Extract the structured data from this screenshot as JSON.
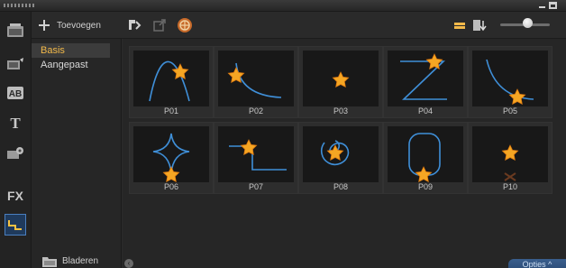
{
  "window": {
    "controls": [
      "minimize",
      "maximize"
    ]
  },
  "sidebar": {
    "icons": [
      {
        "name": "media-icon"
      },
      {
        "name": "instant-project-icon"
      },
      {
        "name": "title-icon",
        "text": "AB"
      },
      {
        "name": "text-icon",
        "text": "T"
      },
      {
        "name": "transition-icon"
      },
      {
        "name": "fx-icon",
        "text": "FX"
      },
      {
        "name": "path-icon",
        "active": true
      }
    ]
  },
  "toolbar": {
    "add_label": "Toevoegen",
    "icons": [
      "import-paths-icon",
      "export-paths-icon",
      "web-library-icon",
      "list-view-icon",
      "sort-icon"
    ],
    "zoom_level": 0.55
  },
  "categories": {
    "items": [
      {
        "label": "Basis",
        "selected": true
      },
      {
        "label": "Aangepast",
        "selected": false
      }
    ],
    "browse_label": "Bladeren"
  },
  "library": {
    "items": [
      {
        "label": "P01"
      },
      {
        "label": "P02"
      },
      {
        "label": "P03"
      },
      {
        "label": "P04"
      },
      {
        "label": "P05"
      },
      {
        "label": "P06"
      },
      {
        "label": "P07"
      },
      {
        "label": "P08"
      },
      {
        "label": "P09"
      },
      {
        "label": "P10"
      }
    ]
  },
  "footer": {
    "options_label": "Opties ^"
  },
  "colors": {
    "accent": "#f2b94a",
    "path_stroke": "#3f8fd8",
    "star": "#f5a623",
    "selection": "#1f3a5c"
  }
}
